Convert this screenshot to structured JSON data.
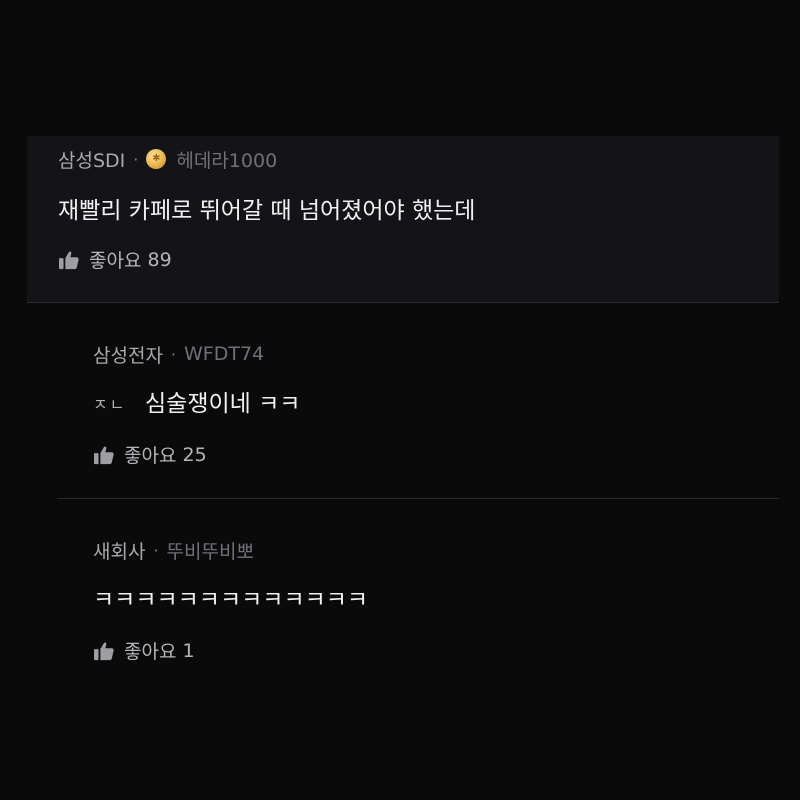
{
  "comments": [
    {
      "company": "삼성SDI",
      "badge_icon": "gold-badge-icon",
      "nickname": "헤데라1000",
      "text": "재빨리 카페로 뛰어갈 때 넘어졌어야 했는데",
      "like_label": "좋아요",
      "like_count": "89"
    },
    {
      "company": "삼성전자",
      "nickname": "WFDT74",
      "text_prefix": "ㅈㄴ",
      "text": "심술쟁이네 ㅋㅋ",
      "like_label": "좋아요",
      "like_count": "25"
    },
    {
      "company": "새회사",
      "nickname": "뚜비뚜비뽀",
      "text": "ㅋㅋㅋㅋㅋㅋㅋㅋㅋㅋㅋㅋㅋ",
      "like_label": "좋아요",
      "like_count": "1"
    }
  ],
  "separator": "·",
  "colors": {
    "background": "#0a0a0b",
    "highlight_card": "#141416",
    "divider": "#2a2a2e",
    "badge": "#e9b24a"
  }
}
